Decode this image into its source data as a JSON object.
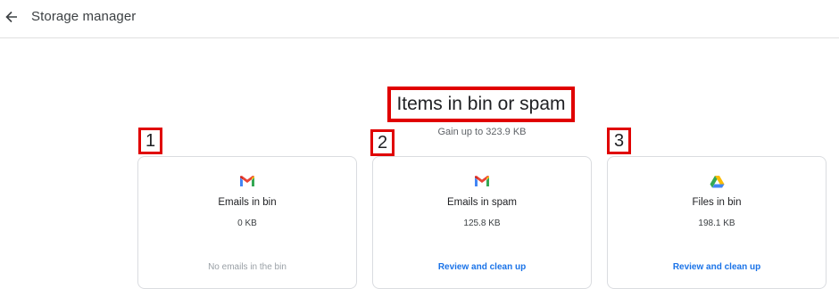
{
  "header": {
    "back_icon": "arrow-left-icon",
    "title": "Storage manager"
  },
  "section": {
    "title": "Items in bin or spam",
    "subtitle": "Gain up to 323.9 KB"
  },
  "markers": [
    "1",
    "2",
    "3"
  ],
  "cards": [
    {
      "icon": "gmail-icon",
      "label": "Emails in bin",
      "size": "0 KB",
      "action": "No emails in the bin",
      "action_enabled": false
    },
    {
      "icon": "gmail-icon",
      "label": "Emails in spam",
      "size": "125.8 KB",
      "action": "Review and clean up",
      "action_enabled": true
    },
    {
      "icon": "google-drive-icon",
      "label": "Files in bin",
      "size": "198.1 KB",
      "action": "Review and clean up",
      "action_enabled": true
    }
  ],
  "colors": {
    "annotation_red": "#e00000",
    "link_blue": "#1a73e8",
    "disabled_gray": "#9aa0a6"
  }
}
